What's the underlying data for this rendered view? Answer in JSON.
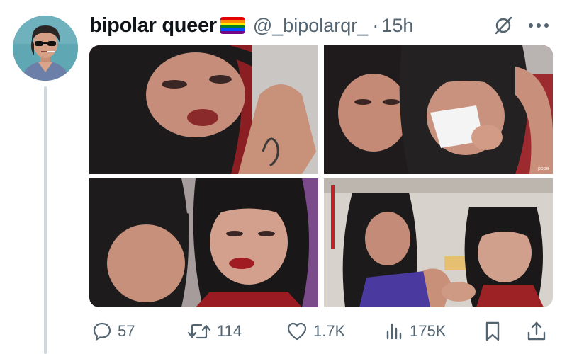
{
  "author": {
    "display_name": "bipolar queer",
    "flag": "rainbow-flag",
    "handle": "@_bipolarqr_",
    "separator": "·",
    "time": "15h"
  },
  "media": {
    "count": 4,
    "watermark": "pope"
  },
  "actions": {
    "replies": "57",
    "reposts": "114",
    "likes": "1.7K",
    "views": "175K"
  },
  "icons": {
    "reply": "speech-bubble-icon",
    "repost": "repost-arrows-icon",
    "like": "heart-icon",
    "views": "bar-chart-icon",
    "bookmark": "bookmark-icon",
    "share": "share-icon",
    "more": "more-dots-icon",
    "grok": "grok-slash-circle-icon"
  },
  "colors": {
    "text_primary": "#0f1419",
    "text_secondary": "#536471",
    "thread_line": "#cfd9de",
    "avatar_bg": "#5ea7b3",
    "flag": [
      "#e40303",
      "#ff8c00",
      "#ffed00",
      "#008026",
      "#004dff",
      "#750787"
    ]
  }
}
